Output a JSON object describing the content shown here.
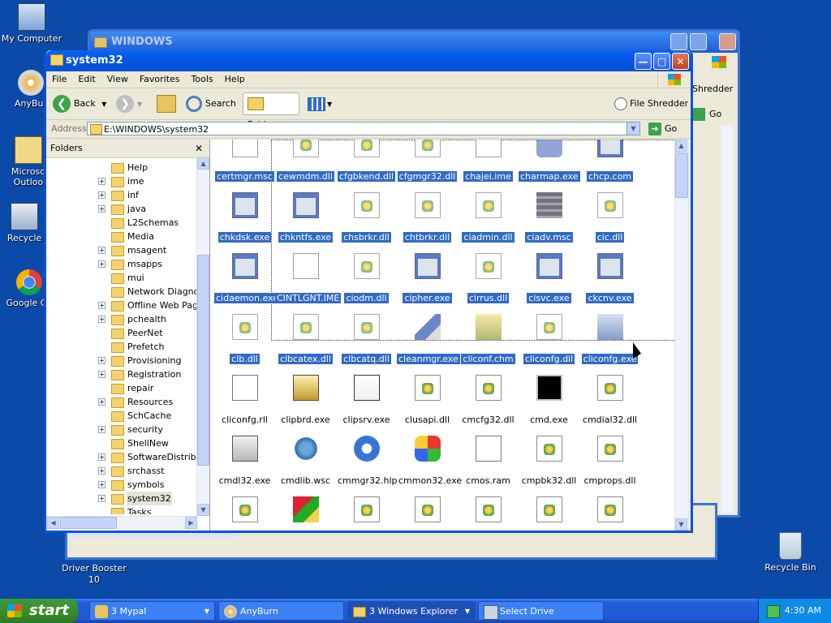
{
  "desktop": {
    "icons": [
      {
        "label": "My Computer"
      },
      {
        "label": "AnyBur"
      },
      {
        "label": "Microso"
      },
      {
        "label": "Outloo"
      },
      {
        "label": "Recycle"
      },
      {
        "label": "Google Ch"
      },
      {
        "label": "Driver Booster"
      },
      {
        "label": "10"
      },
      {
        "label": "Recycle Bin"
      }
    ]
  },
  "back_window": {
    "title": "WINDOWS",
    "toolbar_label": "Shredder",
    "go_label": "Go"
  },
  "window": {
    "title": "system32",
    "menu": [
      "File",
      "Edit",
      "View",
      "Favorites",
      "Tools",
      "Help"
    ],
    "toolbar": {
      "back": "Back",
      "search": "Search",
      "folders": "Folders",
      "file_shredder": "File Shredder"
    },
    "address": {
      "label": "Address",
      "value": "E:\\WINDOWS\\system32",
      "go": "Go"
    },
    "folders_pane": {
      "title": "Folders",
      "items": [
        {
          "label": "Help",
          "expand": ""
        },
        {
          "label": "ime",
          "expand": "+"
        },
        {
          "label": "inf",
          "expand": "+"
        },
        {
          "label": "java",
          "expand": "+"
        },
        {
          "label": "L2Schemas",
          "expand": ""
        },
        {
          "label": "Media",
          "expand": ""
        },
        {
          "label": "msagent",
          "expand": "+"
        },
        {
          "label": "msapps",
          "expand": "+"
        },
        {
          "label": "mui",
          "expand": ""
        },
        {
          "label": "Network Diagnost",
          "expand": ""
        },
        {
          "label": "Offline Web Page",
          "expand": "+"
        },
        {
          "label": "pchealth",
          "expand": "+"
        },
        {
          "label": "PeerNet",
          "expand": ""
        },
        {
          "label": "Prefetch",
          "expand": ""
        },
        {
          "label": "Provisioning",
          "expand": "+"
        },
        {
          "label": "Registration",
          "expand": "+"
        },
        {
          "label": "repair",
          "expand": ""
        },
        {
          "label": "Resources",
          "expand": "+"
        },
        {
          "label": "SchCache",
          "expand": ""
        },
        {
          "label": "security",
          "expand": "+"
        },
        {
          "label": "ShellNew",
          "expand": ""
        },
        {
          "label": "SoftwareDistribut",
          "expand": "+"
        },
        {
          "label": "srchasst",
          "expand": "+"
        },
        {
          "label": "symbols",
          "expand": "+"
        },
        {
          "label": "system32",
          "expand": "+"
        },
        {
          "label": "Tasks",
          "expand": ""
        }
      ]
    },
    "files": [
      {
        "name": "certmgr.msc",
        "type": "msc",
        "selected": true
      },
      {
        "name": "cewmdm.dll",
        "type": "dll",
        "selected": true
      },
      {
        "name": "cfgbkend.dll",
        "type": "dll",
        "selected": true
      },
      {
        "name": "cfgmgr32.dll",
        "type": "dll",
        "selected": true
      },
      {
        "name": "chajei.ime",
        "type": "ime",
        "selected": true
      },
      {
        "name": "charmap.exe",
        "type": "charmap",
        "selected": true
      },
      {
        "name": "chcp.com",
        "type": "exe",
        "selected": true
      },
      {
        "name": "chkdsk.exe",
        "type": "exe",
        "selected": true
      },
      {
        "name": "chkntfs.exe",
        "type": "exe",
        "selected": true
      },
      {
        "name": "chsbrkr.dll",
        "type": "dll",
        "selected": true
      },
      {
        "name": "chtbrkr.dll",
        "type": "dll",
        "selected": true
      },
      {
        "name": "ciadmin.dll",
        "type": "dll",
        "selected": true
      },
      {
        "name": "ciadv.msc",
        "type": "msc2",
        "selected": true
      },
      {
        "name": "cic.dll",
        "type": "dll",
        "selected": true
      },
      {
        "name": "cidaemon.exe",
        "type": "exe",
        "selected": true
      },
      {
        "name": "CINTLGNT.IME",
        "type": "ime",
        "selected": true
      },
      {
        "name": "ciodm.dll",
        "type": "dll",
        "selected": true
      },
      {
        "name": "cipher.exe",
        "type": "exe",
        "selected": true
      },
      {
        "name": "cirrus.dll",
        "type": "dll",
        "selected": true
      },
      {
        "name": "cisvc.exe",
        "type": "exe",
        "selected": true
      },
      {
        "name": "ckcnv.exe",
        "type": "exe",
        "selected": true
      },
      {
        "name": "clb.dll",
        "type": "dll",
        "selected": true
      },
      {
        "name": "clbcatex.dll",
        "type": "dll",
        "selected": true
      },
      {
        "name": "clbcatq.dll",
        "type": "dll",
        "selected": true
      },
      {
        "name": "cleanmgr.exe",
        "type": "cleanmgr",
        "selected": true
      },
      {
        "name": "cliconf.chm",
        "type": "chm",
        "selected": true
      },
      {
        "name": "cliconfg.dll",
        "type": "dll",
        "selected": true
      },
      {
        "name": "cliconfg.exe",
        "type": "net",
        "selected": true
      },
      {
        "name": "cliconfg.rll",
        "type": "doc",
        "selected": false
      },
      {
        "name": "clipbrd.exe",
        "type": "clip",
        "selected": false
      },
      {
        "name": "clipsrv.exe",
        "type": "clipsrv",
        "selected": false
      },
      {
        "name": "clusapi.dll",
        "type": "dll",
        "selected": false
      },
      {
        "name": "cmcfg32.dll",
        "type": "dll",
        "selected": false
      },
      {
        "name": "cmd.exe",
        "type": "cmd",
        "selected": false
      },
      {
        "name": "cmdial32.dll",
        "type": "dll",
        "selected": false
      },
      {
        "name": "cmdl32.exe",
        "type": "phone",
        "selected": false
      },
      {
        "name": "cmdlib.wsc",
        "type": "wsc",
        "selected": false
      },
      {
        "name": "cmmgr32.hlp",
        "type": "hlp",
        "selected": false
      },
      {
        "name": "cmmon32.exe",
        "type": "cmmon",
        "selected": false
      },
      {
        "name": "cmos.ram",
        "type": "ime",
        "selected": false
      },
      {
        "name": "cmpbk32.dll",
        "type": "dll",
        "selected": false
      },
      {
        "name": "cmprops.dll",
        "type": "dll",
        "selected": false
      },
      {
        "name": "",
        "type": "dll",
        "selected": false
      },
      {
        "name": "",
        "type": "cmstp",
        "selected": false
      },
      {
        "name": "",
        "type": "dll",
        "selected": false
      },
      {
        "name": "",
        "type": "dll",
        "selected": false
      },
      {
        "name": "",
        "type": "dll",
        "selected": false
      },
      {
        "name": "",
        "type": "dll",
        "selected": false
      },
      {
        "name": "",
        "type": "dll",
        "selected": false
      }
    ]
  },
  "taskbar": {
    "start": "start",
    "tasks": [
      {
        "label": "3 Mypal",
        "dropdown": true
      },
      {
        "label": "AnyBurn",
        "dropdown": false
      },
      {
        "label": "3 Windows Explorer",
        "dropdown": true
      },
      {
        "label": "Select Drive",
        "dropdown": false
      }
    ],
    "clock": "4:30 AM"
  },
  "colors": {
    "desktop": "#0b4aa8",
    "selection": "#316ac5",
    "titlebar": "#0554e3",
    "start": "#3c8d2f"
  }
}
